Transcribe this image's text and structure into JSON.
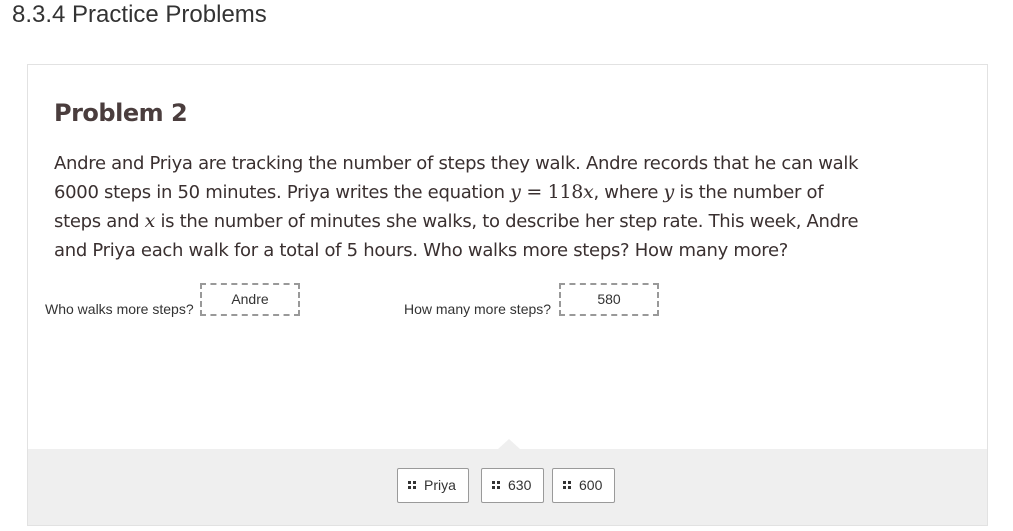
{
  "page": {
    "title": "8.3.4 Practice Problems"
  },
  "problem": {
    "heading": "Problem 2",
    "text": {
      "part1": "Andre and Priya are tracking the number of steps they walk. Andre records that he can walk 6000 steps in 50 minutes. Priya writes the equation ",
      "eq_y": "y",
      "eq_mid": " = 118",
      "eq_x": "x",
      "part2": ", where ",
      "var_y": "y",
      "part3": " is the number of steps and ",
      "var_x": "x",
      "part4": " is the number of minutes she walks, to describe her step rate. This week, Andre and Priya each walk for a total of 5 hours. Who walks more steps? How many more?"
    }
  },
  "questions": [
    {
      "label": "Who walks more steps?",
      "answer": "Andre"
    },
    {
      "label": "How many more steps?",
      "answer": "580"
    }
  ],
  "tray": {
    "chips": [
      {
        "label": "Priya",
        "icon": "drag-grip-icon"
      },
      {
        "label": "630",
        "icon": "drag-grip-icon"
      },
      {
        "label": "600",
        "icon": "drag-grip-icon"
      }
    ]
  }
}
